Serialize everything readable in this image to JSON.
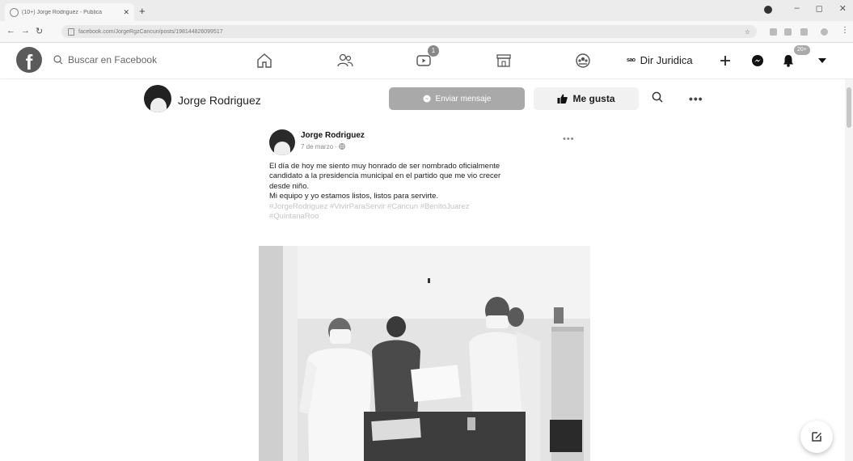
{
  "browser": {
    "tab_title": "(10+) Jorge Rodriguez - Publica",
    "tab_close": "✕",
    "new_tab": "+",
    "url": "facebook.com/JorgeRgzCancun/posts/198144826099517",
    "window_controls": [
      "–",
      "◻",
      "✕"
    ]
  },
  "facebook": {
    "search_placeholder": "Buscar en Facebook",
    "watch_badge": "1",
    "page_switcher_logo": "sao",
    "page_switcher_name": "Dir Juridica",
    "notifications_badge": "20+"
  },
  "page_header": {
    "name": "Jorge Rodriguez",
    "message_button": "Enviar mensaje",
    "like_button": "Me gusta",
    "more": "•••"
  },
  "post": {
    "author": "Jorge Rodriguez",
    "date": "7 de marzo ·",
    "more": "•••",
    "text_lines": [
      "El día de hoy me siento muy honrado de ser nombrado oficialmente",
      "candidato a la presidencia municipal en el partido que me vio crecer",
      "desde niño.",
      "Mi equipo y yo estamos listos, listos para servirte."
    ],
    "hashtag_lines": [
      "#JorgeRodriguez #VivirParaServir #Cancun #BenitoJuarez",
      "#QuintanaRoo"
    ]
  },
  "colors": {
    "message_button": "#a9a9a9",
    "like_button_bg": "#f1f1f1",
    "hashtags": "#c4c4c4"
  },
  "icons": [
    "facebook-logo-icon",
    "search-icon",
    "home-icon",
    "friends-icon",
    "watch-icon",
    "marketplace-icon",
    "groups-icon",
    "plus-icon",
    "messenger-icon",
    "bell-icon",
    "caret-down-icon",
    "messenger-small-icon",
    "like-icon",
    "globe-icon",
    "compose-icon",
    "lock-icon"
  ]
}
